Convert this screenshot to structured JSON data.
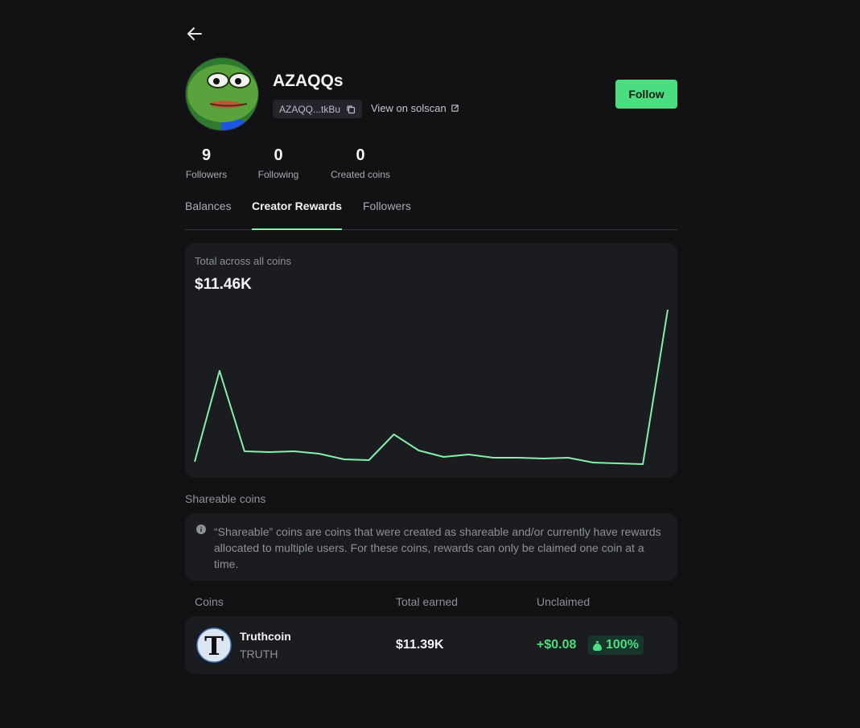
{
  "profile": {
    "username": "AZAQQs",
    "address_short": "AZAQQ...tkBu",
    "solscan_label": "View on solscan",
    "follow_label": "Follow"
  },
  "stats": [
    {
      "value": "9",
      "label": "Followers"
    },
    {
      "value": "0",
      "label": "Following"
    },
    {
      "value": "0",
      "label": "Created coins"
    }
  ],
  "tabs": [
    {
      "label": "Balances",
      "active": false
    },
    {
      "label": "Creator Rewards",
      "active": true
    },
    {
      "label": "Followers",
      "active": false
    }
  ],
  "rewards": {
    "caption": "Total across all coins",
    "total": "$11.46K"
  },
  "chart_data": {
    "type": "line",
    "series": [
      {
        "values": [
          0.3,
          11.6,
          1.6,
          1.5,
          1.6,
          1.3,
          0.6,
          0.5,
          3.7,
          1.7,
          0.9,
          1.2,
          0.8,
          0.8,
          0.7,
          0.8,
          0.2,
          0.1,
          0.0,
          19.2
        ]
      }
    ],
    "ylim": [
      0,
      20
    ],
    "grid": false,
    "color": "#86efac"
  },
  "shareable": {
    "label": "Shareable coins",
    "info": "“Shareable” coins are coins that were created as shareable and/or currently have rewards allocated to multiple users. For these coins, rewards can only be claimed one coin at a time."
  },
  "table": {
    "headers": {
      "coins": "Coins",
      "earned": "Total earned",
      "unclaimed": "Unclaimed"
    },
    "rows": [
      {
        "name": "Truthcoin",
        "ticker": "TRUTH",
        "earned": "$11.39K",
        "unclaimed": "+$0.08",
        "percent": "100%",
        "logo_letter": "T"
      }
    ]
  },
  "colors": {
    "accent": "#4ade80",
    "background": "#121214",
    "card": "#1b1c1f"
  },
  "icons": {
    "back": "arrow-left-icon",
    "copy": "copy-icon",
    "external": "external-link-icon",
    "info": "info-icon",
    "bag": "money-bag-icon"
  }
}
